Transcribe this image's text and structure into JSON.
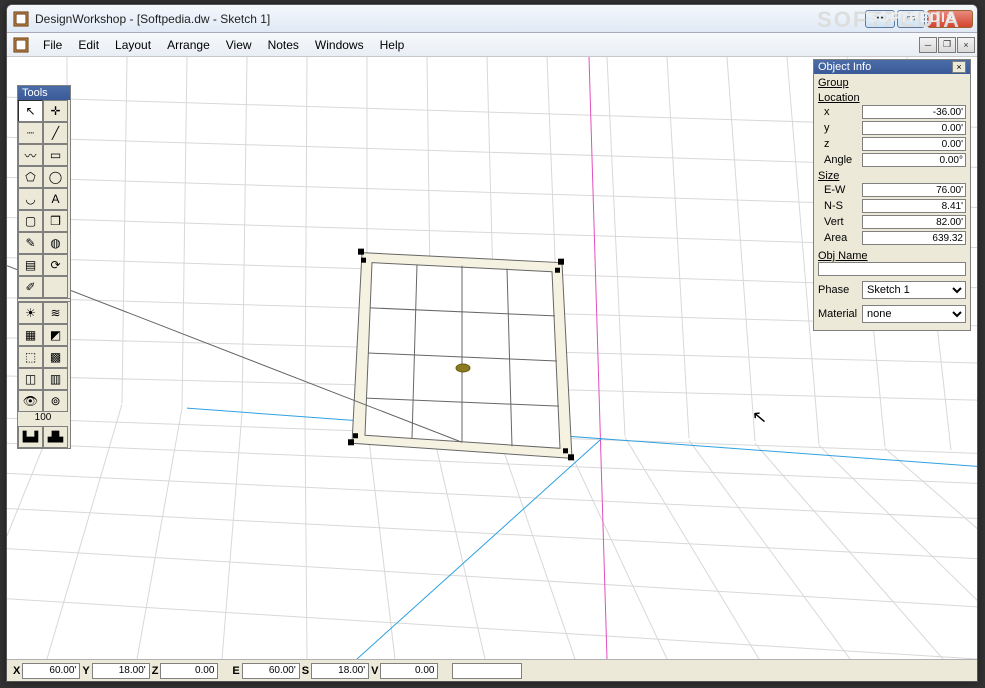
{
  "app": {
    "title": "DesignWorkshop - [Softpedia.dw - Sketch 1]"
  },
  "menu": {
    "items": [
      "File",
      "Edit",
      "Layout",
      "Arrange",
      "View",
      "Notes",
      "Windows",
      "Help"
    ]
  },
  "tools": {
    "title": "Tools",
    "value_display": "100"
  },
  "object_info": {
    "title": "Object Info",
    "group_label": "Group",
    "location_label": "Location",
    "x_label": "x",
    "x": "-36.00'",
    "y_label": "y",
    "y": "0.00'",
    "z_label": "z",
    "z": "0.00'",
    "angle_label": "Angle",
    "angle": "0.00°",
    "size_label": "Size",
    "ew_label": "E-W",
    "ew": "76.00'",
    "ns_label": "N-S",
    "ns": "8.41'",
    "vert_label": "Vert",
    "vert": "82.00'",
    "area_label": "Area",
    "area": "639.32",
    "objname_label": "Obj Name",
    "objname": "",
    "phase_label": "Phase",
    "phase": "Sketch 1",
    "material_label": "Material",
    "material": "none"
  },
  "status": {
    "X_label": "X",
    "X": "60.00'",
    "Y_label": "Y",
    "Y": "18.00'",
    "Z_label": "Z",
    "Z": "0.00",
    "E_label": "E",
    "E": "60.00'",
    "S_label": "S",
    "S": "18.00'",
    "V_label": "V",
    "V": "0.00",
    "extra": ""
  },
  "watermark": "SOFTPEDIA"
}
